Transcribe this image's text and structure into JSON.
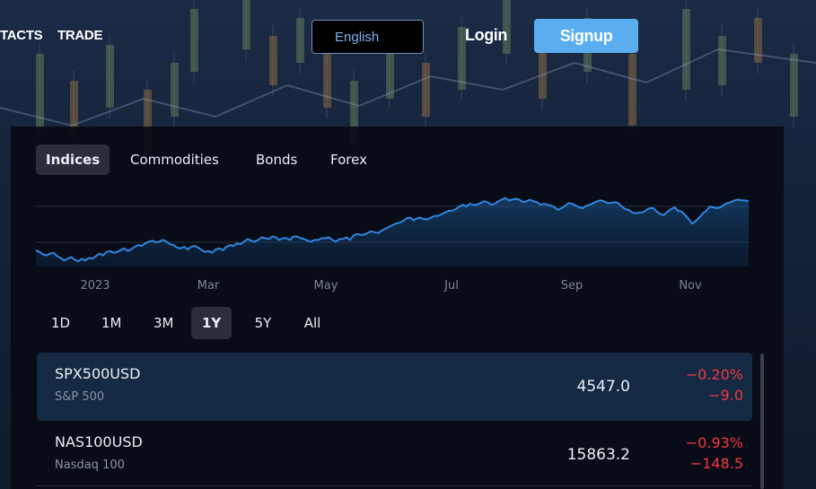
{
  "nav": {
    "contacts_label": "TACTS",
    "trade_label": "TRADE",
    "language": "English",
    "login_label": "Login",
    "signup_label": "Signup"
  },
  "widget": {
    "category_tabs": [
      "Indices",
      "Commodities",
      "Bonds",
      "Forex"
    ],
    "active_category": "Indices",
    "range_tabs": [
      "1D",
      "1M",
      "3M",
      "1Y",
      "5Y",
      "All"
    ],
    "active_range": "1Y",
    "symbols": [
      {
        "symbol": "SPX500USD",
        "name": "S&P 500",
        "price": "4547.0",
        "change_pct": "−0.20%",
        "change": "−9.0"
      },
      {
        "symbol": "NAS100USD",
        "name": "Nasdaq 100",
        "price": "15863.2",
        "change_pct": "−0.93%",
        "change": "−148.5"
      }
    ]
  },
  "colors": {
    "accent": "#5aaef0",
    "line": "#2f86e0",
    "negative": "#f23645",
    "panel": "#070b14"
  },
  "chart_data": {
    "type": "area",
    "title": "",
    "series": [
      {
        "values": [
          3890,
          3870,
          3840,
          3830,
          3850,
          3860,
          3820,
          3800,
          3770,
          3790,
          3810,
          3780,
          3760,
          3790,
          3770,
          3800,
          3790,
          3820,
          3850,
          3830,
          3870,
          3880,
          3860,
          3870,
          3890,
          3910,
          3880,
          3900,
          3930,
          3950,
          3940,
          3970,
          3990,
          4000,
          3980,
          3990,
          4010,
          3990,
          3960,
          3950,
          3920,
          3910,
          3930,
          3900,
          3930,
          3940,
          3920,
          3890,
          3870,
          3880,
          3860,
          3900,
          3910,
          3890,
          3930,
          3950,
          3940,
          3970,
          3960,
          3990,
          4020,
          4000,
          3990,
          4010,
          4040,
          4030,
          4020,
          4050,
          4040,
          4010,
          4030,
          4030,
          4010,
          4050,
          4050,
          4030,
          4020,
          4000,
          3990,
          4010,
          4010,
          4030,
          4030,
          4040,
          4010,
          3990,
          4020,
          4020,
          4040,
          4010,
          4060,
          4080,
          4070,
          4070,
          4090,
          4110,
          4100,
          4090,
          4120,
          4140,
          4160,
          4180,
          4200,
          4210,
          4230,
          4260,
          4270,
          4240,
          4260,
          4270,
          4250,
          4250,
          4270,
          4290,
          4290,
          4310,
          4330,
          4350,
          4350,
          4370,
          4400,
          4420,
          4400,
          4430,
          4420,
          4420,
          4440,
          4460,
          4450,
          4420,
          4430,
          4460,
          4480,
          4500,
          4470,
          4480,
          4490,
          4480,
          4450,
          4460,
          4480,
          4460,
          4450,
          4420,
          4430,
          4420,
          4410,
          4390,
          4360,
          4380,
          4410,
          4440,
          4430,
          4410,
          4390,
          4380,
          4410,
          4420,
          4440,
          4460,
          4470,
          4460,
          4440,
          4440,
          4450,
          4440,
          4400,
          4370,
          4360,
          4330,
          4320,
          4330,
          4330,
          4360,
          4380,
          4380,
          4340,
          4310,
          4300,
          4340,
          4370,
          4390,
          4350,
          4340,
          4300,
          4250,
          4200,
          4230,
          4270,
          4320,
          4350,
          4400,
          4390,
          4380,
          4390,
          4420,
          4440,
          4450,
          4470,
          4480,
          4470,
          4470,
          4460
        ]
      }
    ],
    "x_labels": [
      "2023",
      "Mar",
      "May",
      "Jul",
      "Sep",
      "Nov"
    ],
    "ylim": [
      3700,
      4600
    ],
    "grid": true
  }
}
